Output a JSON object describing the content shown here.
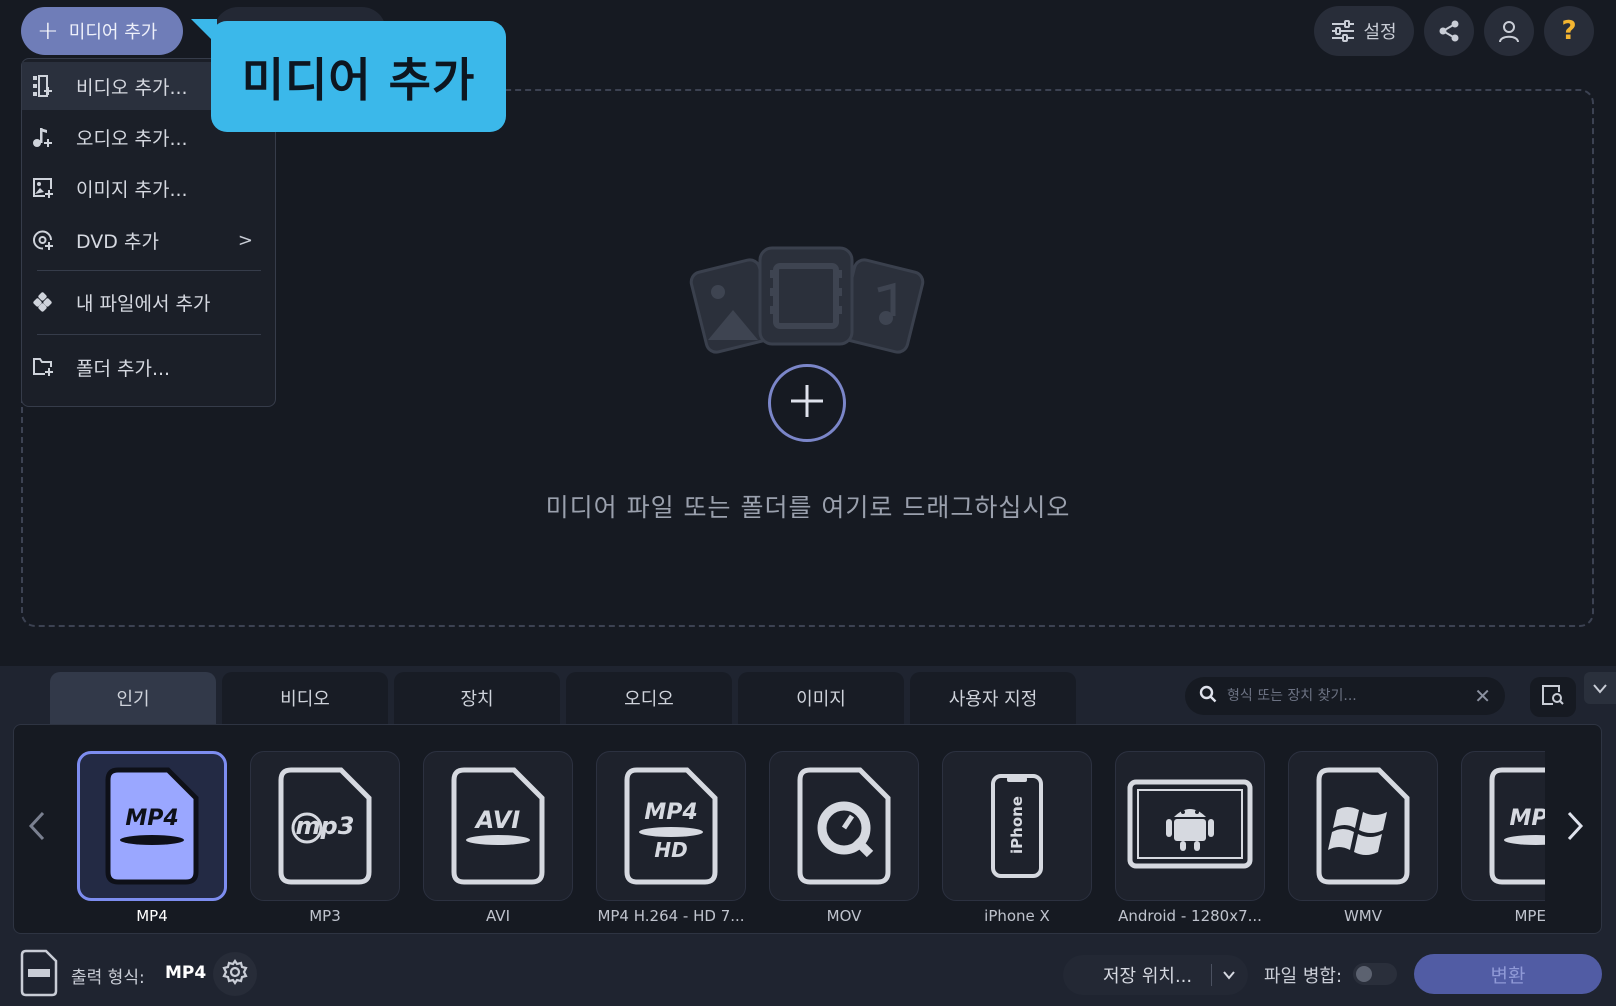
{
  "toolbar": {
    "add_media_label": "미디어 추가",
    "settings_label": "설정",
    "help_label": "?"
  },
  "tooltip": {
    "text": "미디어 추가"
  },
  "add_menu": {
    "items": [
      {
        "label": "비디오 추가...",
        "icon": "video-add-icon"
      },
      {
        "label": "오디오 추가...",
        "icon": "audio-add-icon"
      },
      {
        "label": "이미지 추가...",
        "icon": "image-add-icon"
      },
      {
        "label": "DVD 추가",
        "icon": "dvd-add-icon",
        "submenu": ">"
      },
      {
        "label": "내 파일에서 추가",
        "icon": "my-files-icon"
      },
      {
        "label": "폴더 추가...",
        "icon": "folder-add-icon"
      }
    ]
  },
  "dropzone": {
    "text": "미디어 파일 또는 폴더를 여기로 드래그하십시오"
  },
  "format_tabs": [
    "인기",
    "비디오",
    "장치",
    "오디오",
    "이미지",
    "사용자 지정"
  ],
  "search": {
    "placeholder": "형식 또는 장치 찾기...",
    "clear": "✕"
  },
  "formats": [
    {
      "name": "MP4",
      "selected": true,
      "icon": "mp4-video-icon"
    },
    {
      "name": "MP3",
      "icon": "mp3-icon"
    },
    {
      "name": "AVI",
      "icon": "avi-video-icon"
    },
    {
      "name": "MP4 H.264 - HD 7...",
      "icon": "mp4-hd-icon"
    },
    {
      "name": "MOV",
      "icon": "quicktime-icon"
    },
    {
      "name": "iPhone X",
      "icon": "iphone-icon"
    },
    {
      "name": "Android - 1280x7...",
      "icon": "android-icon"
    },
    {
      "name": "WMV",
      "icon": "windows-icon"
    },
    {
      "name": "MPEG",
      "icon": "mpeg-video-icon"
    }
  ],
  "format_labels": {
    "mp4": "MP4",
    "mp3": "mp3",
    "avi": "AVI",
    "hd": "HD",
    "iphone": "iPhone",
    "mpeg": "MPE"
  },
  "footer": {
    "output_label": "출력 형식:",
    "output_value": "MP4",
    "save_location": "저장 위치...",
    "merge_label": "파일 병합:",
    "convert_label": "변환"
  },
  "colors": {
    "accent": "#6f7db8",
    "tooltip": "#3bb8ea",
    "selected_border": "#7d8df0",
    "help": "#f3b531"
  }
}
